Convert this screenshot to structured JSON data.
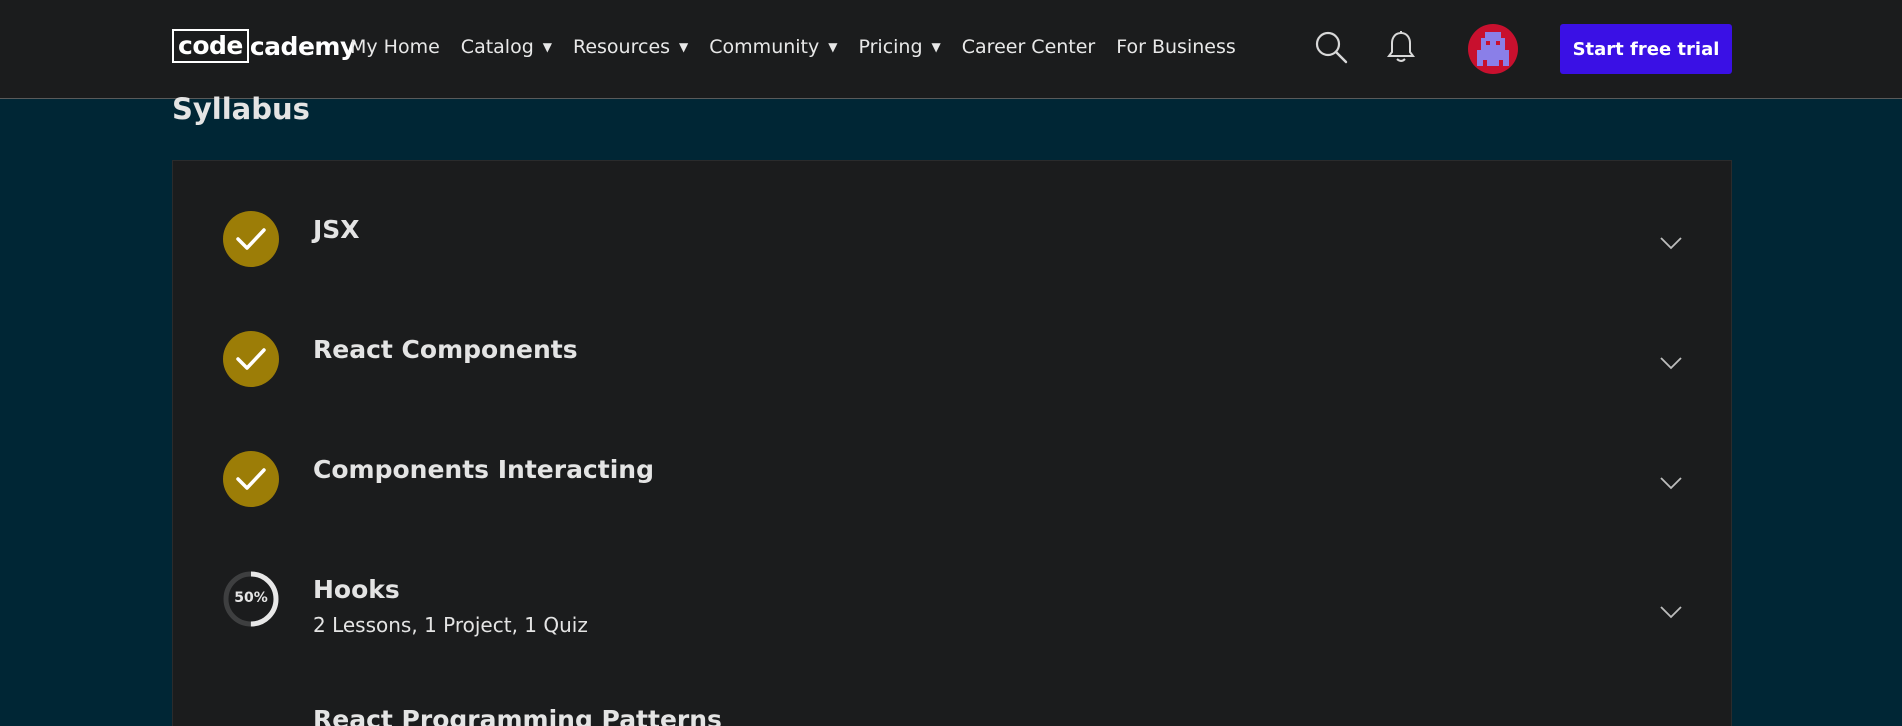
{
  "header": {
    "logo": {
      "boxed": "code",
      "rest": "cademy"
    },
    "nav": [
      {
        "label": "My Home",
        "has_caret": false
      },
      {
        "label": "Catalog",
        "has_caret": true
      },
      {
        "label": "Resources",
        "has_caret": true
      },
      {
        "label": "Community",
        "has_caret": true
      },
      {
        "label": "Pricing",
        "has_caret": true
      },
      {
        "label": "Career Center",
        "has_caret": false
      },
      {
        "label": "For Business",
        "has_caret": false
      }
    ],
    "caret_glyph": "▼",
    "icons": [
      "search-icon",
      "bell-icon",
      "avatar"
    ],
    "cta_label": "Start free trial",
    "cta_color": "#3a10e5"
  },
  "syllabus": {
    "title": "Syllabus",
    "modules": [
      {
        "title": "JSX",
        "status": "complete",
        "subtitle": ""
      },
      {
        "title": "React Components",
        "status": "complete",
        "subtitle": ""
      },
      {
        "title": "Components Interacting",
        "status": "complete",
        "subtitle": ""
      },
      {
        "title": "Hooks",
        "status": "in-progress",
        "progress_label": "50%",
        "progress": 0.5,
        "subtitle": "2 Lessons, 1 Project, 1 Quiz"
      },
      {
        "title": "React Programming Patterns",
        "status": "not-started",
        "subtitle": ""
      }
    ],
    "complete_color": "#9c7d07"
  }
}
